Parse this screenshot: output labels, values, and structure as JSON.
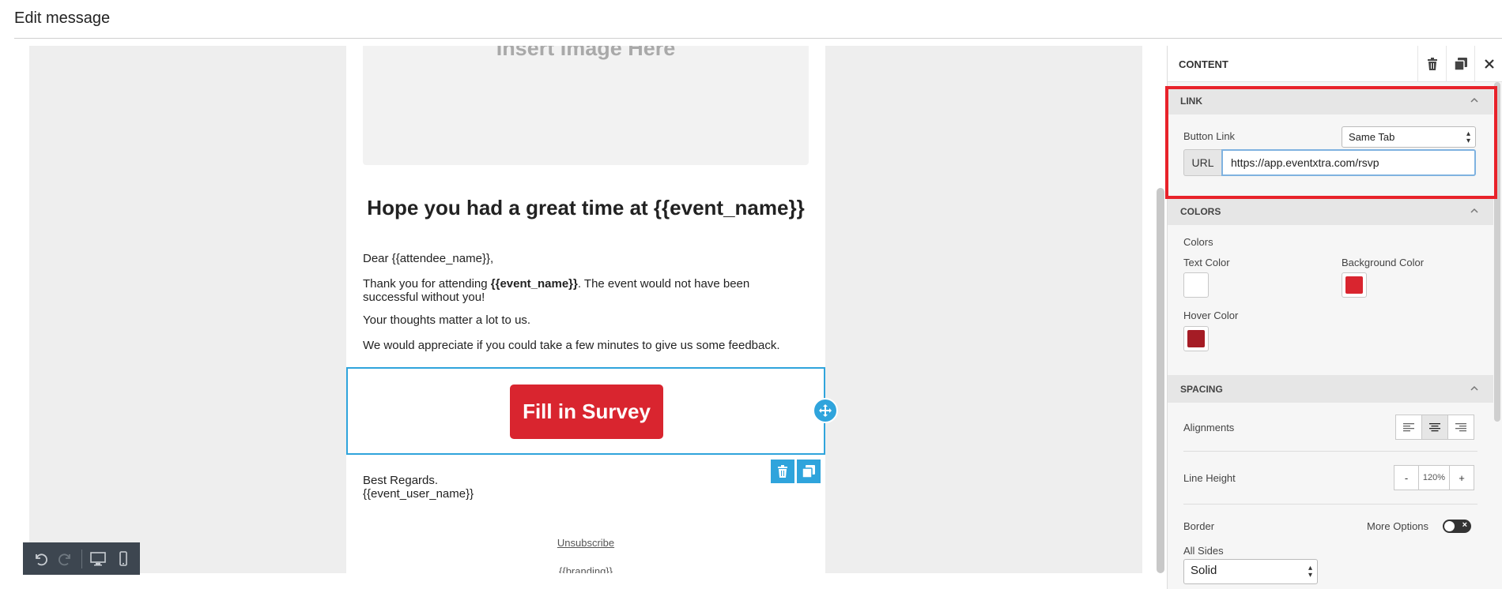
{
  "window": {
    "title": "Edit message"
  },
  "email": {
    "image_placeholder": "Insert Image Here",
    "heading": "Hope you had a great time at {{event_name}}",
    "greeting": "Dear {{attendee_name}},",
    "thanks_prefix": "Thank you for attending ",
    "thanks_bold": "{{event_name}}",
    "thanks_suffix": ". The event would not have been successful without you!",
    "thoughts": "Your thoughts matter a lot to us.",
    "appreciate": "We would appreciate if you could take a few minutes to give us some feedback.",
    "button_label": "Fill in Survey",
    "signoff": "Best Regards.",
    "signature": "{{event_user_name}}",
    "unsubscribe": "Unsubscribe",
    "branding": "{{branding}}"
  },
  "panel": {
    "title": "CONTENT",
    "sections": {
      "link": "LINK",
      "colors": "COLORS",
      "spacing": "SPACING"
    },
    "link": {
      "button_link_label": "Button Link",
      "target_value": "Same Tab",
      "url_addon": "URL",
      "url_value": "https://app.eventxtra.com/rsvp"
    },
    "colors": {
      "group_label": "Colors",
      "text_color_label": "Text Color",
      "background_color_label": "Background Color",
      "hover_color_label": "Hover Color",
      "text_color": "#ffffff",
      "background_color": "#d9252f",
      "hover_color": "#a51c25"
    },
    "spacing": {
      "alignments_label": "Alignments",
      "line_height_label": "Line Height",
      "line_height_minus": "-",
      "line_height_value": "120%",
      "line_height_plus": "+",
      "border_label": "Border",
      "more_options_label": "More Options",
      "all_sides_label": "All Sides",
      "border_style_value": "Solid"
    }
  },
  "colors": {
    "accent": "#2fa4dc",
    "highlight": "#e8222a"
  }
}
